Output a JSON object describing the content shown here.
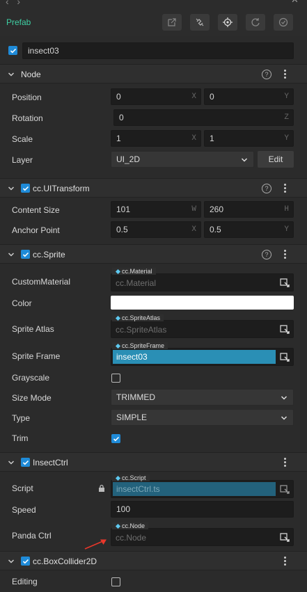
{
  "header": {
    "prefab_label": "Prefab",
    "toolbar_icons": [
      "open-external-icon",
      "unlink-prefab-icon",
      "locate-icon",
      "revert-icon",
      "apply-icon"
    ]
  },
  "node_name": {
    "checked": true,
    "value": "insect03"
  },
  "node_section": {
    "title": "Node",
    "position": {
      "label": "Position",
      "x": "0",
      "y": "0",
      "x_unit": "X",
      "y_unit": "Y"
    },
    "rotation": {
      "label": "Rotation",
      "z": "0",
      "z_unit": "Z"
    },
    "scale": {
      "label": "Scale",
      "x": "1",
      "y": "1",
      "x_unit": "X",
      "y_unit": "Y"
    },
    "layer": {
      "label": "Layer",
      "value": "UI_2D",
      "edit_label": "Edit"
    }
  },
  "uitransform": {
    "title": "cc.UITransform",
    "content_size": {
      "label": "Content Size",
      "w": "101",
      "h": "260",
      "w_unit": "W",
      "h_unit": "H"
    },
    "anchor_point": {
      "label": "Anchor Point",
      "x": "0.5",
      "y": "0.5",
      "x_unit": "X",
      "y_unit": "Y"
    }
  },
  "sprite": {
    "title": "cc.Sprite",
    "custom_material": {
      "label": "CustomMaterial",
      "tag": "cc.Material",
      "placeholder": "cc.Material"
    },
    "color": {
      "label": "Color",
      "value": "#ffffff"
    },
    "sprite_atlas": {
      "label": "Sprite Atlas",
      "tag": "cc.SpriteAtlas",
      "placeholder": "cc.SpriteAtlas"
    },
    "sprite_frame": {
      "label": "Sprite Frame",
      "tag": "cc.SpriteFrame",
      "value": "insect03"
    },
    "grayscale": {
      "label": "Grayscale",
      "checked": false
    },
    "size_mode": {
      "label": "Size Mode",
      "value": "TRIMMED"
    },
    "type": {
      "label": "Type",
      "value": "SIMPLE"
    },
    "trim": {
      "label": "Trim",
      "checked": true
    }
  },
  "insect_ctrl": {
    "title": "InsectCtrl",
    "script": {
      "label": "Script",
      "tag": "cc.Script",
      "value": "insectCtrl.ts"
    },
    "speed": {
      "label": "Speed",
      "value": "100"
    },
    "panda_ctrl": {
      "label": "Panda Ctrl",
      "tag": "cc.Node",
      "placeholder": "cc.Node"
    }
  },
  "box_collider": {
    "title": "cc.BoxCollider2D",
    "editing": {
      "label": "Editing",
      "checked": false
    }
  },
  "colors": {
    "accent_blue": "#1f8bd8",
    "prefab_green": "#3ecfa3",
    "selected_asset": "#2a8fb5",
    "annotation_arrow": "#e8372b"
  }
}
